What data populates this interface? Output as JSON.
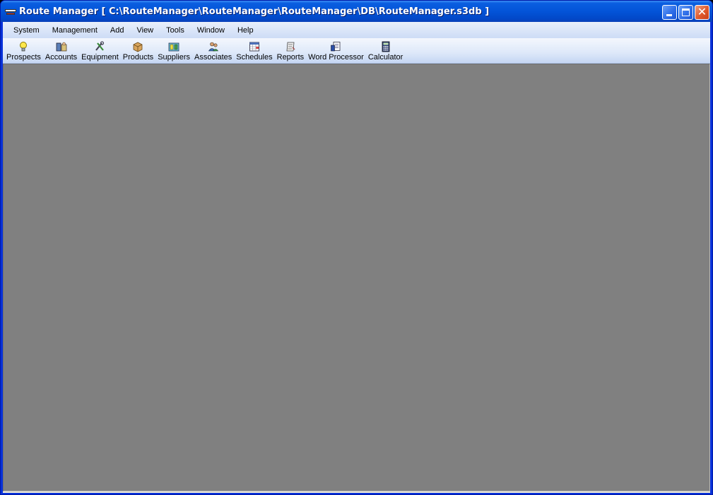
{
  "window": {
    "title": "Route Manager [ C:\\RouteManager\\RouteManager\\RouteManager\\DB\\RouteManager.s3db ]",
    "icon": "route-manager-app-icon"
  },
  "controls": {
    "minimize_icon": "minimize-icon",
    "maximize_icon": "maximize-icon",
    "close_icon": "close-icon",
    "close_glyph": "✕"
  },
  "menu": [
    {
      "label": "System"
    },
    {
      "label": "Management"
    },
    {
      "label": "Add"
    },
    {
      "label": "View"
    },
    {
      "label": "Tools"
    },
    {
      "label": "Window"
    },
    {
      "label": "Help"
    }
  ],
  "toolbar": [
    {
      "label": "Prospects",
      "icon": "lightbulb-icon"
    },
    {
      "label": "Accounts",
      "icon": "accounts-icon"
    },
    {
      "label": "Equipment",
      "icon": "equipment-icon"
    },
    {
      "label": "Products",
      "icon": "products-box-icon"
    },
    {
      "label": "Suppliers",
      "icon": "suppliers-icon"
    },
    {
      "label": "Associates",
      "icon": "associates-people-icon"
    },
    {
      "label": "Schedules",
      "icon": "calendar-icon"
    },
    {
      "label": "Reports",
      "icon": "reports-icon"
    },
    {
      "label": "Word Processor",
      "icon": "word-processor-icon"
    },
    {
      "label": "Calculator",
      "icon": "calculator-icon"
    }
  ],
  "colors": {
    "titlebar": "#0354d8",
    "menubar": "#cddcf6",
    "mdi_background": "#808080",
    "close_button": "#e05a2c"
  }
}
